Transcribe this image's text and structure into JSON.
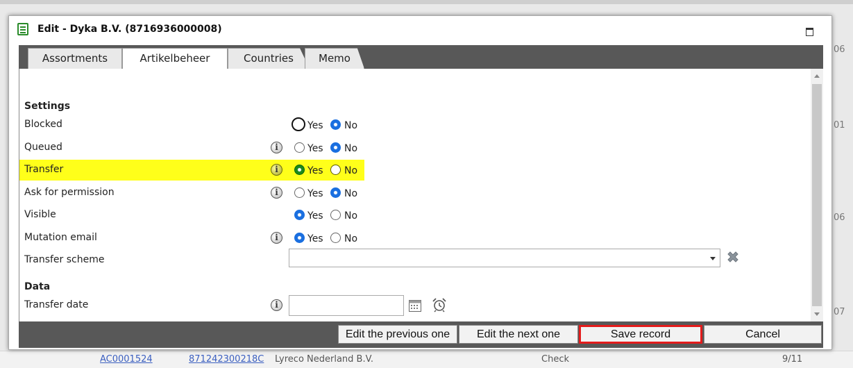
{
  "background": {
    "right_column": [
      "06",
      "01",
      "06",
      "07"
    ],
    "bottom_row": {
      "code": "AC0001524",
      "ean": "871242300218C",
      "company": "Lyreco Nederland B.V.",
      "status": "Check",
      "page": "9/11"
    }
  },
  "dialog": {
    "title": "Edit - Dyka B.V. (8716936000008)",
    "title_icon": "form-icon",
    "tabs": [
      {
        "label": "Assortments",
        "active": false
      },
      {
        "label": "Artikelbeheer",
        "active": true
      },
      {
        "label": "Countries",
        "active": false
      },
      {
        "label": "Memo",
        "active": false
      }
    ],
    "sections": {
      "settings": "Settings",
      "data": "Data"
    },
    "options": {
      "yes": "Yes",
      "no": "No"
    },
    "fields": {
      "blocked": {
        "label": "Blocked",
        "value": "No"
      },
      "queued": {
        "label": "Queued",
        "value": "No"
      },
      "transfer": {
        "label": "Transfer",
        "value": "Yes"
      },
      "ask_permission": {
        "label": "Ask for permission",
        "value": "No"
      },
      "visible": {
        "label": "Visible",
        "value": "Yes"
      },
      "mutation_email": {
        "label": "Mutation email",
        "value": "Yes"
      },
      "transfer_scheme": {
        "label": "Transfer scheme",
        "value": ""
      },
      "transfer_date": {
        "label": "Transfer date",
        "value": ""
      }
    },
    "buttons": {
      "prev": "Edit the previous one",
      "next": "Edit the next one",
      "save": "Save record",
      "cancel": "Cancel"
    },
    "colors": {
      "highlight": "#ffff1a",
      "selected_radio": "#1a6fe0",
      "save_border": "#e41b1b",
      "bar": "#585858"
    }
  }
}
